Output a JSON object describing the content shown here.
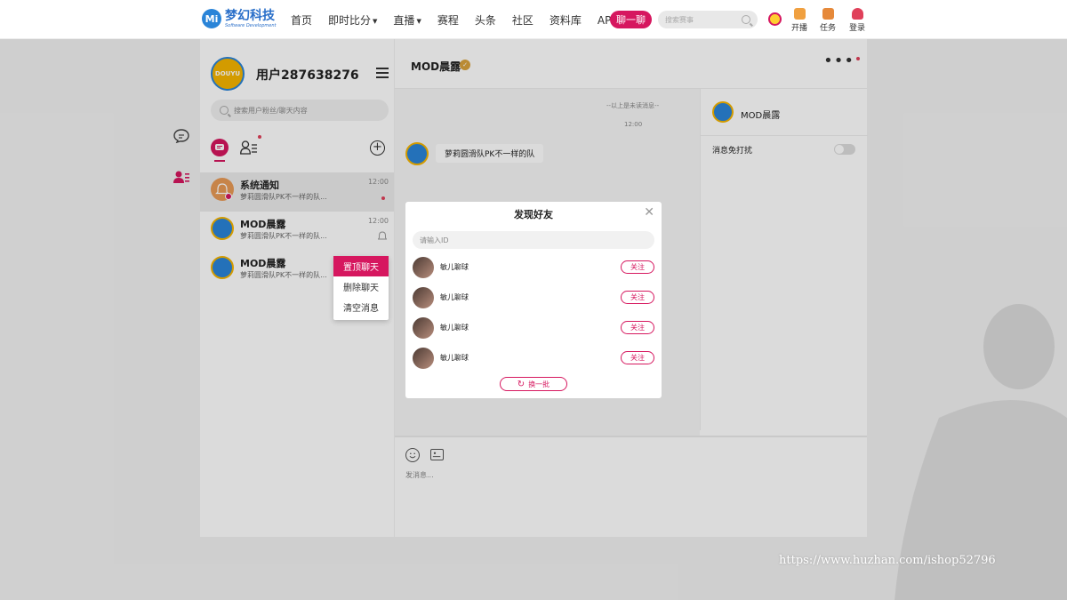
{
  "brand": {
    "logo_mark": "Mi",
    "name": "梦幻科技",
    "subtitle": "Software Development"
  },
  "nav": {
    "items": [
      "首页",
      "即时比分",
      "直播",
      "赛程",
      "头条",
      "社区",
      "资料库",
      "APP下载"
    ],
    "chat_button": "聊一聊",
    "search_placeholder": "搜索赛事",
    "open_live": "开播",
    "tasks": "任务",
    "login": "登录"
  },
  "user": {
    "name": "用户287638276",
    "avatar_text": "DOUYU"
  },
  "sidebar": {
    "search_placeholder": "搜索用户粉丝/聊天内容"
  },
  "conversations": [
    {
      "name": "系统通知",
      "preview": "萝莉圆滑队PK不一样的队...",
      "time": "12:00"
    },
    {
      "name": "MOD晨露",
      "preview": "萝莉圆滑队PK不一样的队...",
      "time": "12:00"
    },
    {
      "name": "MOD晨露",
      "preview": "萝莉圆滑队PK不一样的队..."
    }
  ],
  "context_menu": [
    "置顶聊天",
    "删除聊天",
    "清空消息"
  ],
  "chat": {
    "title": "MOD晨露",
    "system_tip": "--以上是未读消息--",
    "time": "12:00",
    "message": "萝莉圆滑队PK不一样的队",
    "input_placeholder": "发消息..."
  },
  "info": {
    "name": "MOD晨露",
    "mute_label": "消息免打扰",
    "mute_on": false
  },
  "modal": {
    "title": "发现好友",
    "input_placeholder": "请输入ID",
    "friends": [
      "敏儿聊球",
      "敏儿聊球",
      "敏儿聊球",
      "敏儿聊球"
    ],
    "follow_label": "关注",
    "refresh_label": "换一批"
  },
  "watermark": "https://www.huzhan.com/ishop52796",
  "colors": {
    "accent": "#d6175f",
    "brand": "#2a6fc9"
  }
}
